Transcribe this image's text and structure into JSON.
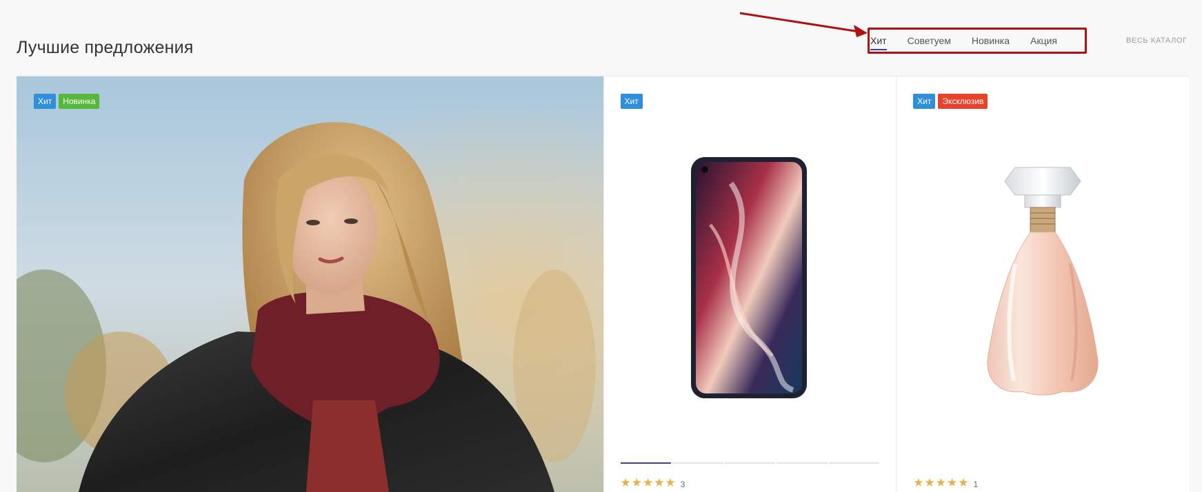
{
  "header": {
    "title": "Лучшие предложения",
    "tabs": [
      {
        "label": "Хит",
        "active": true
      },
      {
        "label": "Советуем",
        "active": false
      },
      {
        "label": "Новинка",
        "active": false
      },
      {
        "label": "Акция",
        "active": false
      }
    ],
    "catalog_link": "Весь каталог"
  },
  "colors": {
    "badge_hit": "#2f8fd8",
    "badge_new": "#56b83a",
    "badge_exclusive": "#e8432a",
    "annotation": "#b01010",
    "accent": "#3a3fa3",
    "stars": "#e3b34a"
  },
  "banner": {
    "badges": [
      "Хит",
      "Новинка"
    ],
    "image": "woman-in-leather-jacket-photo"
  },
  "products": [
    {
      "badges": [
        "Хит"
      ],
      "image": "smartphone-icon",
      "stars": "★★★★★",
      "rating_count": "3",
      "gallery_dots": 5,
      "active_dot": 0
    },
    {
      "badges": [
        "Хит",
        "Эксклюзив"
      ],
      "image": "perfume-bottle-icon",
      "stars": "★★★★★",
      "rating_count": "1"
    }
  ]
}
